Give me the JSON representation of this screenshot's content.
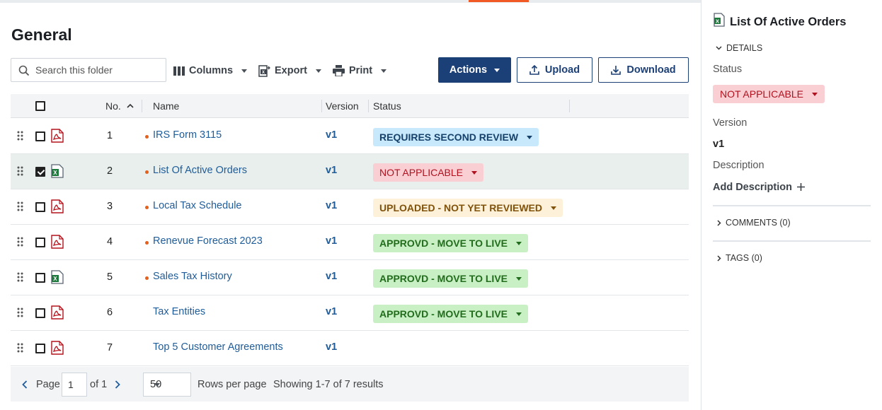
{
  "page": {
    "title": "General"
  },
  "toolbar": {
    "search_placeholder": "Search this folder",
    "columns_label": "Columns",
    "export_label": "Export",
    "print_label": "Print",
    "actions_label": "Actions",
    "upload_label": "Upload",
    "download_label": "Download"
  },
  "table": {
    "headers": {
      "no": "No.",
      "name": "Name",
      "version": "Version",
      "status": "Status"
    },
    "rows": [
      {
        "no": "1",
        "name": "IRS Form 3115",
        "version": "v1",
        "status": "REQUIRES SECOND REVIEW",
        "file_icon": "pdf-file-icon",
        "checked": false,
        "dot": true,
        "status_color": "blue"
      },
      {
        "no": "2",
        "name": "List Of Active Orders",
        "version": "v1",
        "status": "NOT APPLICABLE",
        "file_icon": "excel-file-icon",
        "checked": true,
        "dot": true,
        "status_color": "red"
      },
      {
        "no": "3",
        "name": "Local Tax Schedule",
        "version": "v1",
        "status": "UPLOADED - NOT YET REVIEWED",
        "file_icon": "pdf-file-icon",
        "checked": false,
        "dot": true,
        "status_color": "yellow"
      },
      {
        "no": "4",
        "name": "Renevue Forecast 2023",
        "version": "v1",
        "status": "APPROVD - MOVE TO LIVE",
        "file_icon": "pdf-file-icon",
        "checked": false,
        "dot": true,
        "status_color": "green"
      },
      {
        "no": "5",
        "name": "Sales Tax History",
        "version": "v1",
        "status": "APPROVD - MOVE TO LIVE",
        "file_icon": "excel-file-icon",
        "checked": false,
        "dot": true,
        "status_color": "green"
      },
      {
        "no": "6",
        "name": "Tax Entities",
        "version": "v1",
        "status": "APPROVD - MOVE TO LIVE",
        "file_icon": "pdf-file-icon",
        "checked": false,
        "dot": false,
        "status_color": "green"
      },
      {
        "no": "7",
        "name": "Top 5 Customer Agreements",
        "version": "v1",
        "status": "",
        "file_icon": "pdf-file-icon",
        "checked": false,
        "dot": false,
        "status_color": ""
      }
    ]
  },
  "pagination": {
    "page_label": "Page",
    "current_page": "1",
    "of_label": "of 1",
    "rows_per_page_value": "50",
    "rows_per_page_label": "Rows per page",
    "showing": "Showing 1-7 of 7 results"
  },
  "panel": {
    "title": "List Of Active Orders",
    "details_label": "DETAILS",
    "status_label": "Status",
    "status_value": "NOT APPLICABLE",
    "version_label": "Version",
    "version_value": "v1",
    "description_label": "Description",
    "add_description": "Add Description",
    "comments_label": "COMMENTS (0)",
    "tags_label": "TAGS (0)"
  },
  "colors": {
    "accent": "#f15a24",
    "primary": "#1b3f77",
    "link": "#1f5c99",
    "selected_row": "#e8efed"
  }
}
